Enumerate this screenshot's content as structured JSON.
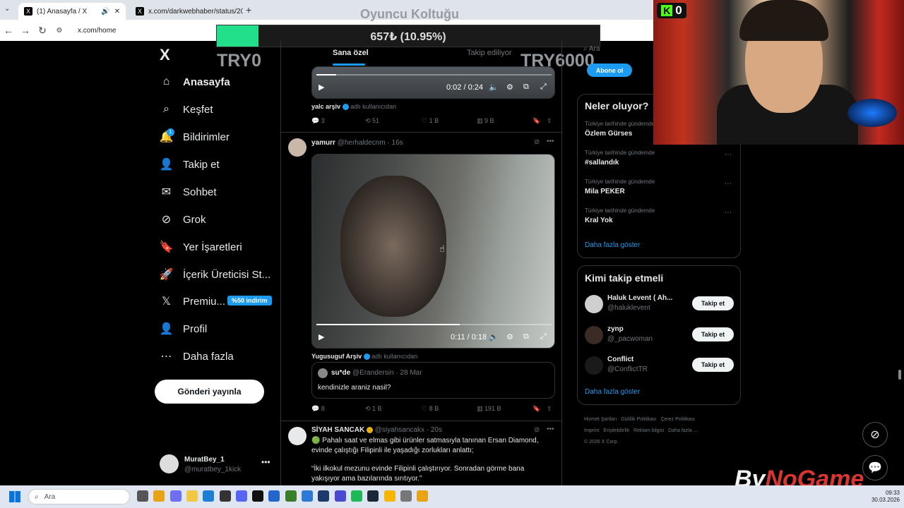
{
  "browser": {
    "tabs": [
      {
        "title": "(1) Anasayfa / X",
        "active": true
      },
      {
        "title": "x.com/darkwebhaber/status/20",
        "active": false
      }
    ],
    "url": "x.com/home"
  },
  "overlay": {
    "title": "Oyuncu Koltuğu",
    "progress_text": "657₺ (10.95%)",
    "progress_fraction": 0.1095,
    "left_label": "TRY0",
    "right_label": "TRY6000"
  },
  "kick": {
    "count": "0"
  },
  "nav": {
    "logo": "X",
    "items": [
      {
        "label": "Anasayfa",
        "icon": "home-icon"
      },
      {
        "label": "Keşfet",
        "icon": "search-icon"
      },
      {
        "label": "Bildirimler",
        "icon": "bell-icon"
      },
      {
        "label": "Takip et",
        "icon": "follow-icon"
      },
      {
        "label": "Sohbet",
        "icon": "mail-icon"
      },
      {
        "label": "Grok",
        "icon": "grok-icon"
      },
      {
        "label": "Yer İşaretleri",
        "icon": "bookmark-icon"
      },
      {
        "label": "İçerik Üreticisi St...",
        "icon": "rocket-icon"
      },
      {
        "label": "Premiu...",
        "icon": "x-icon"
      },
      {
        "label": "Profil",
        "icon": "person-icon"
      },
      {
        "label": "Daha fazla",
        "icon": "more-icon"
      }
    ],
    "notif_badge": "1",
    "premium_badge": "%50 indirim",
    "post_button": "Gönderi yayınla",
    "account": {
      "name": "MuratBey_1",
      "handle": "@muratbey_1kick"
    }
  },
  "feed": {
    "tabs": [
      "Sana özel",
      "Takip ediliyor"
    ],
    "post1": {
      "video_time": "0:02 / 0:24",
      "video_progress": 0.083,
      "reposted_by": "yalc arşiv",
      "reposted_suffix": "adlı kullanıcıdan",
      "replies": "3",
      "reposts": "51",
      "likes": "1 B",
      "views": "9 B"
    },
    "post2": {
      "name": "yamurr",
      "handle": "@herhaldecnm",
      "time": "· 16s",
      "video_time": "0:11 / 0:18",
      "video_progress": 0.61,
      "reposted_by": "Yugusuguf Arşiv",
      "reposted_suffix": "adlı kullanıcıdan",
      "quote_name": "su*de",
      "quote_handle": "@Erandersin",
      "quote_time": "· 28 Mar",
      "quote_text": "kendinizle araniz nasil?",
      "replies": "8",
      "reposts": "1 B",
      "likes": "8 B",
      "views": "191 B"
    },
    "post3": {
      "name": "SİYAH SANCAK",
      "handle": "@siyahsancakx",
      "time": "· 20s",
      "text1": "🟢 Pahalı saat ve elmas gibi ürünler satmasıyla tanınan Ersan Diamond, evinde çalıştığı Filipinli ile yaşadığı zorlukları anlattı;",
      "text2": "“İki ilkokul mezunu evinde Filipinli çalıştırıyor. Sonradan görme bana yakışıyor ama bazılarında sırıtıyor.”"
    }
  },
  "right": {
    "search_placeholder": "Ara",
    "subscribe_button": "Abone ol",
    "trends_title": "Neler oluyor?",
    "trends": [
      {
        "sub": "Türkiye tarihinde gündemde",
        "title": "Özlem Gürses"
      },
      {
        "sub": "Türkiye tarihinde gündemde",
        "title": "#sallandık"
      },
      {
        "sub": "Türkiye tarihinde gündemde",
        "title": "Mila PEKER"
      },
      {
        "sub": "Türkiye tarihinde gündemde",
        "title": "Kral Yok"
      }
    ],
    "trends_more": "Daha fazla göster",
    "follow_title": "Kimi takip etmeli",
    "follow": [
      {
        "name": "Haluk Levent ( Ah...",
        "handle": "@haluklevent",
        "button": "Takip et"
      },
      {
        "name": "zynp",
        "handle": "@_pacwoman",
        "button": "Takip et"
      },
      {
        "name": "Conflict",
        "handle": "@ConflictTR",
        "button": "Takip et"
      }
    ],
    "follow_more": "Daha fazla göster",
    "footer": [
      "Hizmet Şartları",
      "Gizlilik Politikası",
      "Çerez Politikası",
      "Imprint",
      "Erişilebilirlik",
      "Reklam bilgisi",
      "Daha fazla ...",
      "© 2026 X Corp."
    ]
  },
  "watermark": {
    "part1": "By",
    "part2": "NoGame"
  },
  "taskbar": {
    "search_placeholder": "Ara",
    "time": "09:33",
    "date": "30.03.2026"
  }
}
